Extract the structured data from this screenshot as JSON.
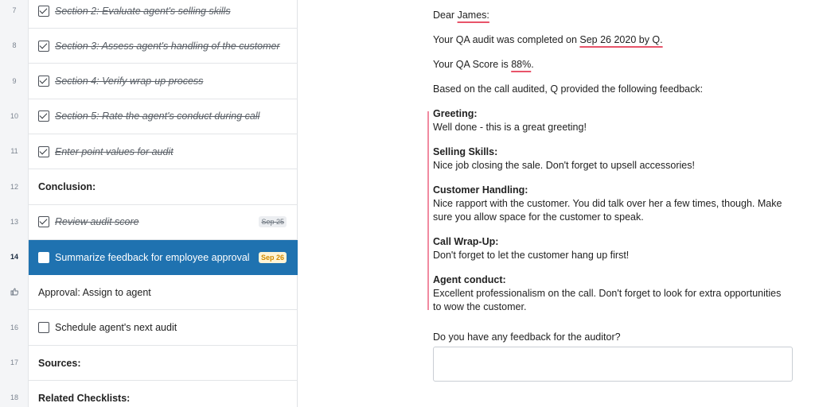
{
  "steps": [
    {
      "num": "7",
      "label": "Section 2: Evaluate agent's selling skills",
      "checked": true,
      "done": true
    },
    {
      "num": "8",
      "label": "Section 3: Assess agent's handling of the customer",
      "checked": true,
      "done": true
    },
    {
      "num": "9",
      "label": "Section 4: Verify wrap-up process",
      "checked": true,
      "done": true
    },
    {
      "num": "10",
      "label": "Section 5: Rate the agent's conduct during call",
      "checked": true,
      "done": true
    },
    {
      "num": "11",
      "label": "Enter point values for audit",
      "checked": true,
      "done": true
    },
    {
      "num": "12",
      "label": "Conclusion:",
      "heading": true
    },
    {
      "num": "13",
      "label": "Review audit score",
      "checked": true,
      "done": true,
      "badge": "Sep 25"
    },
    {
      "num": "14",
      "label": "Summarize feedback for employee approval",
      "checked": false,
      "active": true,
      "badge": "Sep 26"
    },
    {
      "num": "thumbs-up-icon",
      "label": "Approval: Assign to agent",
      "approval": true
    },
    {
      "num": "16",
      "label": "Schedule agent's next audit",
      "checked": false
    },
    {
      "num": "17",
      "label": "Sources:",
      "heading": true
    },
    {
      "num": "18",
      "label": "Related Checklists:",
      "heading": true
    }
  ],
  "content": {
    "greeting_prefix": "Dear ",
    "name": "James:",
    "completed_prefix": "Your QA audit was completed on ",
    "completed_date": "Sep 26 2020 by Q.",
    "score_prefix": "Your QA Score is ",
    "score": "88%",
    "score_suffix": ".",
    "feedback_intro": "Based on the call audited, Q provided the following feedback:",
    "feedback": [
      {
        "title": "Greeting:",
        "text": "Well done - this is a great greeting!"
      },
      {
        "title": "Selling Skills:",
        "text": "Nice job closing the sale. Don't forget to upsell accessories!"
      },
      {
        "title": "Customer Handling:",
        "text": "Nice rapport with the customer. You did talk over her a few times, though. Make sure you allow space for the customer to speak."
      },
      {
        "title": "Call Wrap-Up:",
        "text": "Don't forget to let the customer hang up first!"
      },
      {
        "title": "Agent conduct:",
        "text": "Excellent professionalism on the call. Don't forget to look for extra opportunities to wow the customer."
      }
    ],
    "question": "Do you have any feedback for the auditor?",
    "answer_value": ""
  },
  "colors": {
    "active": "#1f72b0",
    "highlight": "#e8546a",
    "due_badge": "#d08a00"
  }
}
